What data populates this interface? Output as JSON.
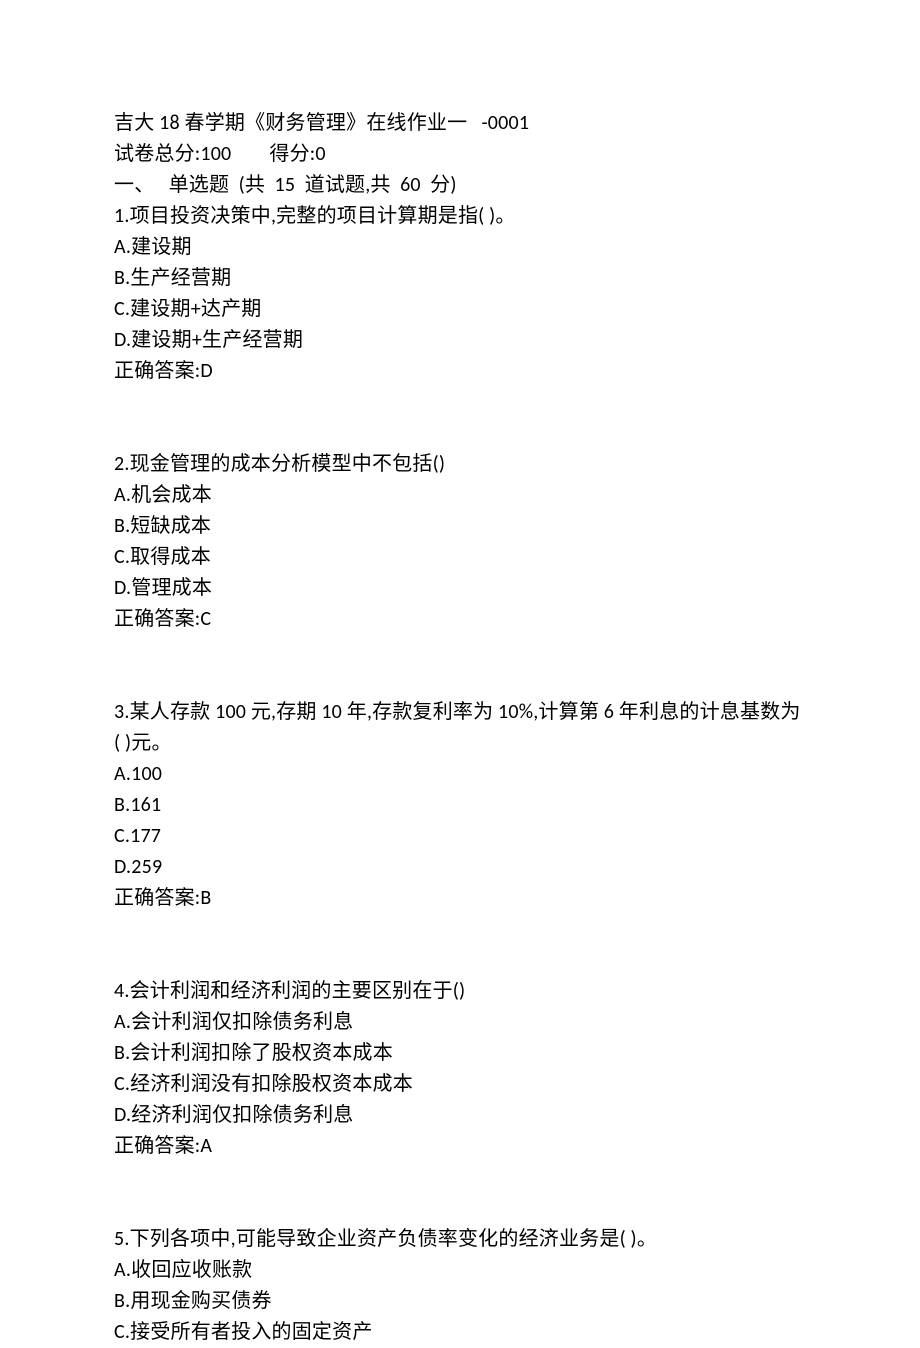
{
  "header": {
    "title": "吉大 18 春学期《财务管理》在线作业一   -0001",
    "totals_label": "试卷总分:",
    "totals_value": "100",
    "score_label": "得分:",
    "score_value": "0",
    "section_line": "一、   单选题  (共  15  道试题,共  60  分)"
  },
  "questions": [
    {
      "stem": "1.项目投资决策中,完整的项目计算期是指( )。",
      "options": [
        "A.建设期",
        "B.生产经营期",
        "C.建设期+达产期",
        "D.建设期+生产经营期"
      ],
      "answer_label": "正确答案:",
      "answer_value": "D"
    },
    {
      "stem": "2.现金管理的成本分析模型中不包括()",
      "options": [
        "A.机会成本",
        "B.短缺成本",
        "C.取得成本",
        "D.管理成本"
      ],
      "answer_label": "正确答案:",
      "answer_value": "C"
    },
    {
      "stem": "3.某人存款 100 元,存期 10 年,存款复利率为 10%,计算第 6 年利息的计息基数为( )元。",
      "options": [
        "A.100",
        "B.161",
        "C.177",
        "D.259"
      ],
      "answer_label": "正确答案:",
      "answer_value": "B"
    },
    {
      "stem": "4.会计利润和经济利润的主要区别在于()",
      "options": [
        "A.会计利润仅扣除债务利息",
        "B.会计利润扣除了股权资本成本",
        "C.经济利润没有扣除股权资本成本",
        "D.经济利润仅扣除债务利息"
      ],
      "answer_label": "正确答案:",
      "answer_value": "A"
    },
    {
      "stem": "5.下列各项中,可能导致企业资产负债率变化的经济业务是( )。",
      "options": [
        "A.收回应收账款",
        "B.用现金购买债券",
        "C.接受所有者投入的固定资产"
      ],
      "answer_label": "",
      "answer_value": ""
    }
  ]
}
